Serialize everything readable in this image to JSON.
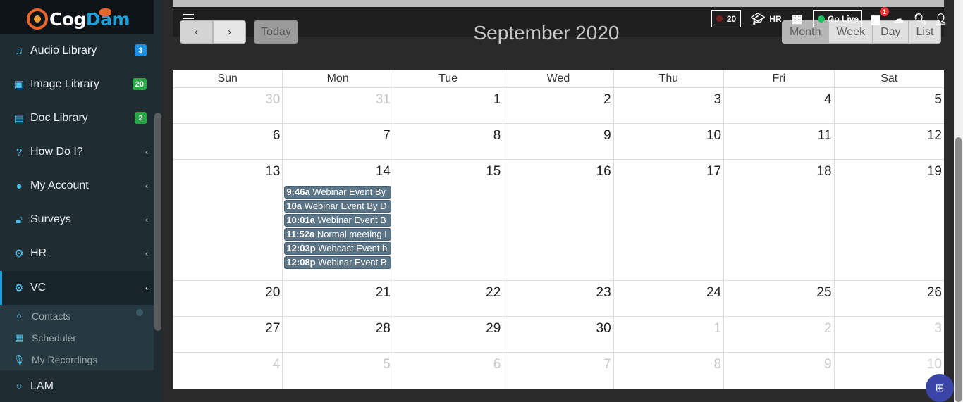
{
  "brand": {
    "name_part1": "Cog",
    "name_part2": "Dam"
  },
  "sidebar": {
    "items": [
      {
        "label": "Audio Library",
        "icon": "music-note-icon",
        "badge": "3",
        "badge_color": "#1a8fe3"
      },
      {
        "label": "Image Library",
        "icon": "image-icon",
        "badge": "20",
        "badge_color": "#28a745"
      },
      {
        "label": "Doc Library",
        "icon": "document-icon",
        "badge": "2",
        "badge_color": "#28a745"
      },
      {
        "label": "How Do I?",
        "icon": "question-circle-icon"
      },
      {
        "label": "My Account",
        "icon": "user-icon"
      },
      {
        "label": "Surveys",
        "icon": "unlock-icon"
      },
      {
        "label": "HR",
        "icon": "cogs-icon"
      },
      {
        "label": "VC",
        "icon": "cogs-icon",
        "active": true
      },
      {
        "label": "LAM",
        "icon": "circle-icon"
      }
    ],
    "vc_sub": [
      {
        "label": "Contacts",
        "icon": "circle-icon"
      },
      {
        "label": "Scheduler",
        "icon": "calendar-icon"
      },
      {
        "label": "My Recordings",
        "icon": "microphone-icon"
      }
    ]
  },
  "toolbar": {
    "count": "20",
    "hr_label": "HR",
    "golive_label": "Go Live",
    "chat_badge": "1"
  },
  "calendar": {
    "title": "September 2020",
    "today_label": "Today",
    "views": [
      "Month",
      "Week",
      "Day",
      "List"
    ],
    "active_view": "Month",
    "weekdays": [
      "Sun",
      "Mon",
      "Tue",
      "Wed",
      "Thu",
      "Fri",
      "Sat"
    ],
    "weeks": [
      [
        {
          "n": "30",
          "other": true
        },
        {
          "n": "31",
          "other": true
        },
        {
          "n": "1"
        },
        {
          "n": "2"
        },
        {
          "n": "3"
        },
        {
          "n": "4"
        },
        {
          "n": "5"
        }
      ],
      [
        {
          "n": "6"
        },
        {
          "n": "7"
        },
        {
          "n": "8"
        },
        {
          "n": "9"
        },
        {
          "n": "10"
        },
        {
          "n": "11"
        },
        {
          "n": "12"
        }
      ],
      [
        {
          "n": "13"
        },
        {
          "n": "14"
        },
        {
          "n": "15"
        },
        {
          "n": "16"
        },
        {
          "n": "17"
        },
        {
          "n": "18"
        },
        {
          "n": "19"
        }
      ],
      [
        {
          "n": "20"
        },
        {
          "n": "21"
        },
        {
          "n": "22"
        },
        {
          "n": "23"
        },
        {
          "n": "24"
        },
        {
          "n": "25"
        },
        {
          "n": "26"
        }
      ],
      [
        {
          "n": "27"
        },
        {
          "n": "28"
        },
        {
          "n": "29"
        },
        {
          "n": "30"
        },
        {
          "n": "1",
          "other": true
        },
        {
          "n": "2",
          "other": true
        },
        {
          "n": "3",
          "other": true
        }
      ],
      [
        {
          "n": "4",
          "other": true
        },
        {
          "n": "5",
          "other": true
        },
        {
          "n": "6",
          "other": true
        },
        {
          "n": "7",
          "other": true
        },
        {
          "n": "8",
          "other": true
        },
        {
          "n": "9",
          "other": true
        },
        {
          "n": "10",
          "other": true
        }
      ]
    ],
    "events": [
      {
        "time": "9:46a",
        "title": "Webinar Event By"
      },
      {
        "time": "10a",
        "title": "Webinar Event By D"
      },
      {
        "time": "10:01a",
        "title": "Webinar Event B"
      },
      {
        "time": "11:52a",
        "title": "Normal meeting I"
      },
      {
        "time": "12:03p",
        "title": "Webcast Event b"
      },
      {
        "time": "12:08p",
        "title": "Webinar Event B"
      }
    ]
  }
}
